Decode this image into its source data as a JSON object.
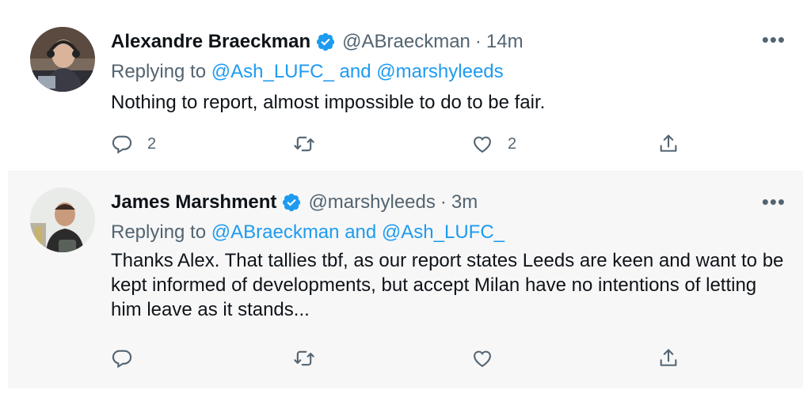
{
  "tweets": [
    {
      "name": "Alexandre Braeckman",
      "handle": "@ABraeckman",
      "separator": "·",
      "time": "14m",
      "replying_prefix": "Replying to",
      "mention1": "@Ash_LUFC_",
      "and": "and",
      "mention2": "@marshyleeds",
      "text": "Nothing to report, almost impossible to do to be fair.",
      "reply_count": "2",
      "retweet_count": "",
      "like_count": "2"
    },
    {
      "name": "James Marshment",
      "handle": "@marshyleeds",
      "separator": "·",
      "time": "3m",
      "replying_prefix": "Replying to",
      "mention1": "@ABraeckman",
      "and": "and",
      "mention2": "@Ash_LUFC_",
      "text": "Thanks Alex. That tallies tbf, as our report states Leeds are keen and want to be kept informed of developments, but accept Milan have no intentions of letting him leave as it stands...",
      "reply_count": "",
      "retweet_count": "",
      "like_count": ""
    }
  ],
  "more_label": "•••",
  "colors": {
    "link": "#1d9bf0",
    "secondary_text": "#536471",
    "verified_badge": "#1d9bf0",
    "thread_line": "#cfd9de"
  },
  "icons": [
    "verified-badge-icon",
    "reply-icon",
    "retweet-icon",
    "like-icon",
    "share-icon",
    "more-icon"
  ]
}
